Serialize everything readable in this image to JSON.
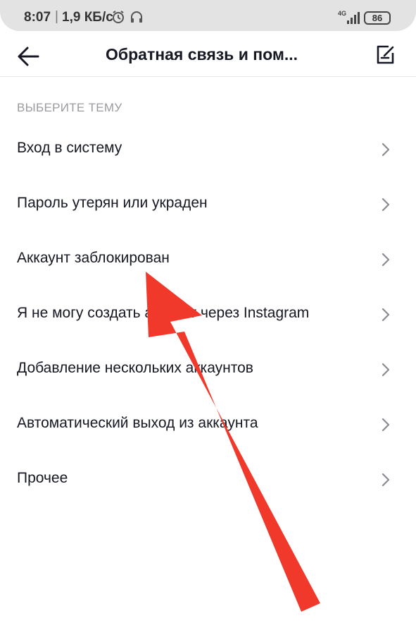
{
  "status": {
    "time": "8:07",
    "separator": "|",
    "speed": "1,9 КБ/с",
    "network": "4G",
    "battery": "86",
    "icons": [
      "alarm-icon",
      "headset-icon",
      "signal-icon",
      "battery-icon"
    ]
  },
  "header": {
    "title": "Обратная связь и пом...",
    "back_icon": "arrow-left-icon",
    "edit_icon": "edit-icon"
  },
  "section": {
    "label": "ВЫБЕРИТЕ ТЕМУ"
  },
  "topics": [
    {
      "label": "Вход в систему"
    },
    {
      "label": "Пароль утерян или украден"
    },
    {
      "label": "Аккаунт заблокирован"
    },
    {
      "label": "Я не могу создать аккаунт через Instagram"
    },
    {
      "label": "Добавление нескольких аккаунтов"
    },
    {
      "label": "Автоматический выход из аккаунта"
    },
    {
      "label": "Прочее"
    }
  ],
  "colors": {
    "text": "#161823",
    "muted": "#9a9ba0",
    "chevron": "#8a8b91",
    "annotation_arrow": "#f0392b"
  }
}
